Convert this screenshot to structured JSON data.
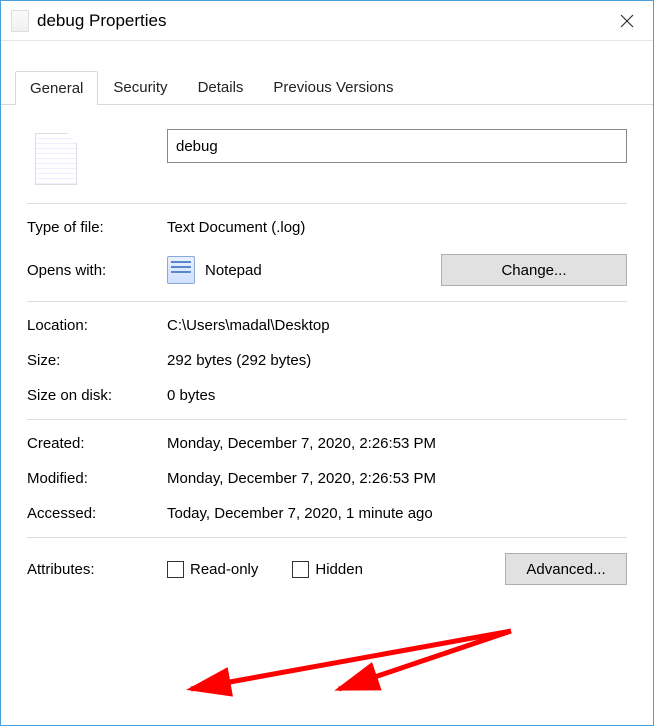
{
  "window": {
    "title": "debug Properties"
  },
  "tabs": {
    "general": "General",
    "security": "Security",
    "details": "Details",
    "previous_versions": "Previous Versions"
  },
  "filename_value": "debug",
  "labels": {
    "type_of_file": "Type of file:",
    "opens_with": "Opens with:",
    "location": "Location:",
    "size": "Size:",
    "size_on_disk": "Size on disk:",
    "created": "Created:",
    "modified": "Modified:",
    "accessed": "Accessed:",
    "attributes": "Attributes:"
  },
  "values": {
    "type_of_file": "Text Document (.log)",
    "opens_with": "Notepad",
    "location": "C:\\Users\\madal\\Desktop",
    "size": "292 bytes (292 bytes)",
    "size_on_disk": "0 bytes",
    "created": "Monday, December 7, 2020, 2:26:53 PM",
    "modified": "Monday, December 7, 2020, 2:26:53 PM",
    "accessed": "Today, December 7, 2020, 1 minute ago"
  },
  "buttons": {
    "change": "Change...",
    "advanced": "Advanced..."
  },
  "attributes": {
    "read_only": "Read-only",
    "hidden": "Hidden"
  }
}
